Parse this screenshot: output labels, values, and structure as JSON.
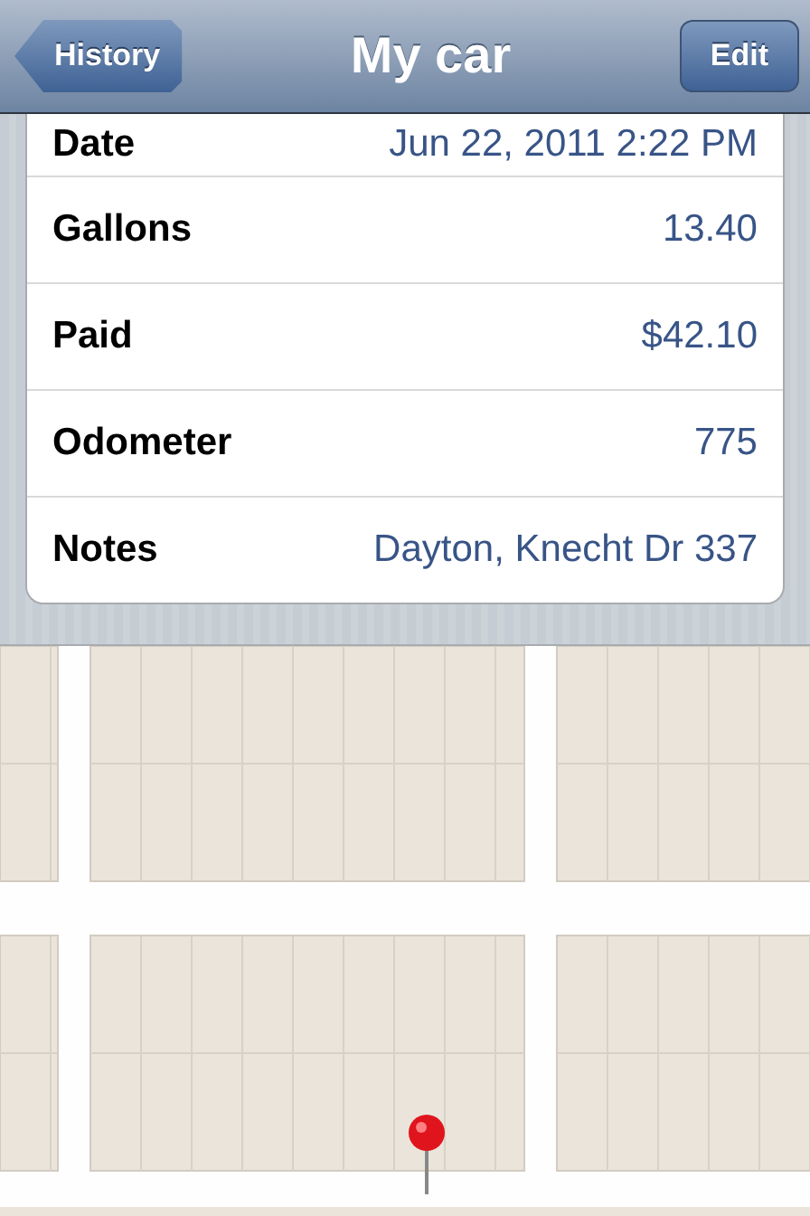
{
  "nav_bar": {
    "back_button": "History",
    "title": "My car",
    "edit_button": "Edit"
  },
  "details": [
    {
      "label": "Date",
      "value": "Jun 22, 2011 2:22 PM"
    },
    {
      "label": "Gallons",
      "value": "13.40"
    },
    {
      "label": "Paid",
      "value": "$42.10"
    },
    {
      "label": "Odometer",
      "value": "775"
    },
    {
      "label": "Notes",
      "value": "Dayton, Knecht Dr 337"
    }
  ]
}
